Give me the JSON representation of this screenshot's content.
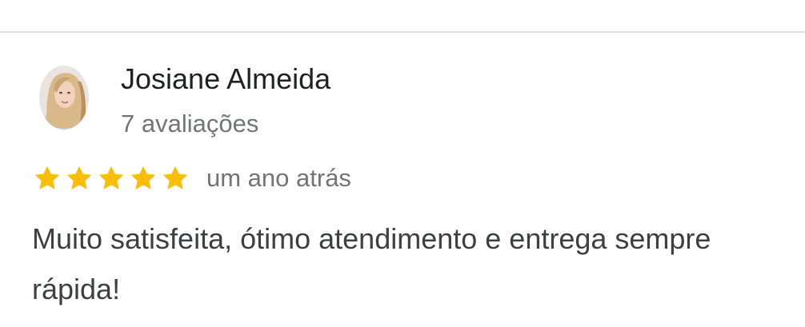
{
  "review": {
    "author_name": "Josiane Almeida",
    "author_meta": "7 avaliações",
    "rating": 5,
    "rating_max": 5,
    "star_color": "#fbbc04",
    "time": "um ano atrás",
    "text": "Muito satisfeita, ótimo atendimento e entrega sempre rápida!"
  }
}
